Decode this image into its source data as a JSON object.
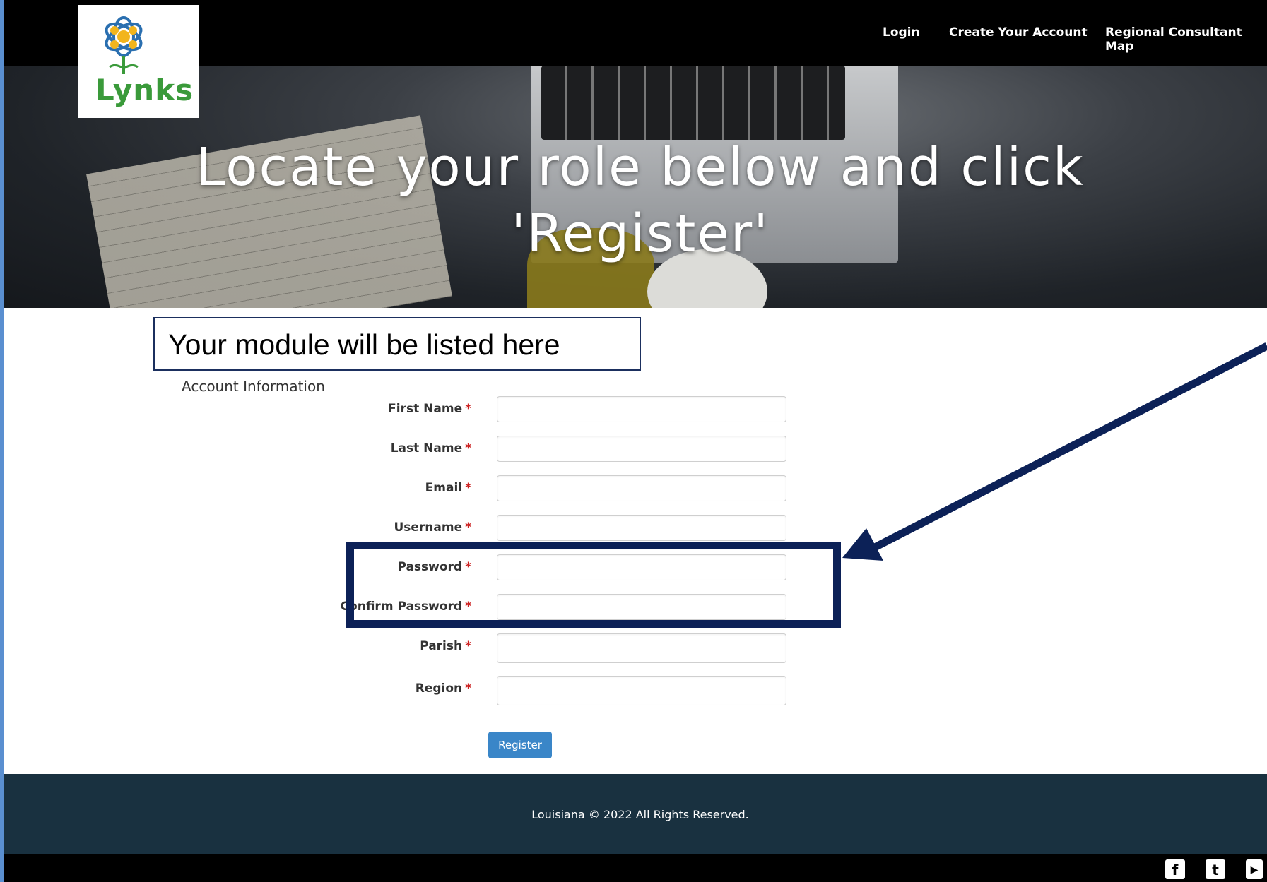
{
  "nav": {
    "login": "Login",
    "create_account": "Create Your Account",
    "regional_map": "Regional Consultant Map"
  },
  "logo": {
    "text": "Lynks"
  },
  "hero": {
    "line1": "Locate your role below and click",
    "line2": "'Register'"
  },
  "callout": {
    "text": "Your module will be listed here"
  },
  "form": {
    "section_title": "Account Information",
    "required_mark": "*",
    "fields": [
      {
        "label": "First Name"
      },
      {
        "label": "Last Name"
      },
      {
        "label": "Email"
      },
      {
        "label": "Username"
      },
      {
        "label": "Password"
      },
      {
        "label": "Confirm Password"
      },
      {
        "label": "Parish"
      },
      {
        "label": "Region"
      }
    ],
    "register_label": "Register"
  },
  "footer": {
    "copyright": "Louisiana © 2022 All Rights Reserved."
  },
  "social": [
    {
      "icon": "facebook-icon",
      "glyph": "f"
    },
    {
      "icon": "twitter-icon",
      "glyph": "t"
    },
    {
      "icon": "youtube-icon",
      "glyph": "▶"
    }
  ],
  "colors": {
    "highlight_border": "#0c2157",
    "register_button": "#3a86c8",
    "footer_bg": "#193140",
    "required": "#cc2222"
  }
}
